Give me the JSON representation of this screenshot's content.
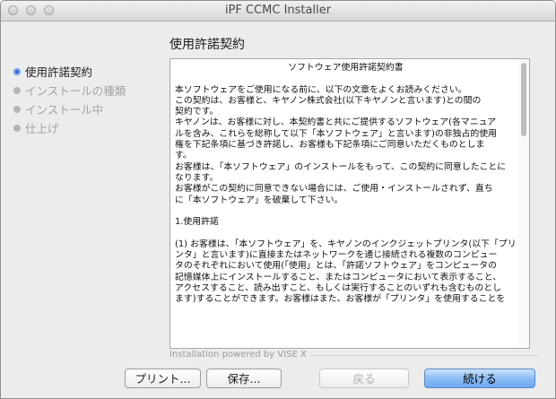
{
  "window": {
    "title": "iPF CCMC Installer"
  },
  "page_heading": "使用許諾契約",
  "steps": [
    {
      "label": "使用許諾契約",
      "state": "active"
    },
    {
      "label": "インストールの種類",
      "state": "inactive"
    },
    {
      "label": "インストール中",
      "state": "inactive"
    },
    {
      "label": "仕上げ",
      "state": "inactive"
    }
  ],
  "license": {
    "title": "ソフトウェア使用許諾契約書",
    "lines": [
      "本ソフトウェアをご使用になる前に、以下の文章をよくお読みください。",
      "この契約は、お客様と、キヤノン株式会社(以下キヤノンと言います)との間の",
      "契約です。",
      "キヤノンは、お客様に対し、本契約書と共にご提供するソフトウェア(各マニュア",
      "ルを含み、これらを総称して以下「本ソフトウェア」と言います)の非独占的使用",
      "権を下記条項に基づき許諾し、お客様も下記条項にご同意いただくものとしま",
      "す。",
      "お客様は、「本ソフトウェア」のインストールをもって、この契約に同意したことに",
      "なります。",
      "お客様がこの契約に同意できない場合には、ご使用・インストールされず、直ち",
      "に「本ソフトウェア」を破棄して下さい。",
      "",
      "1.使用許諾",
      "",
      "(1) お客様は、「本ソフトウェア」を、キヤノンのインクジェットプリンタ(以下「プリ",
      "ンタ」と言います)に直接またはネットワークを通じ接続される複数のコンピュー",
      "タのそれぞれにおいて使用(「使用」とは、「許諾ソフトウェア」をコンピュータの",
      "記憶媒体上にインストールすること、またはコンピュータにおいて表示すること、",
      "アクセスすること、読み出すこと、もしくは実行することのいずれも含むものとし",
      "ます)することができます。お客様はまた、お客様が「プリンタ」を使用することを"
    ]
  },
  "footer": {
    "powered_by": "Installation powered by VISE X"
  },
  "buttons": {
    "print": "プリント...",
    "save": "保存...",
    "back": "戻る",
    "continue": "続ける"
  }
}
